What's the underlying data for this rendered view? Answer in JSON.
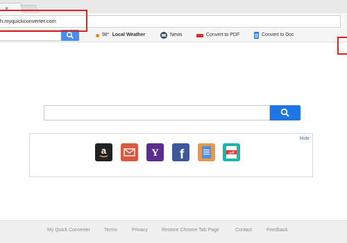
{
  "browser": {
    "tab_close_glyph": "×",
    "url": "h.myquickconverter.com"
  },
  "toolbar": {
    "weather_temp": "98°",
    "weather_label": "Local Weather",
    "news_label": "News",
    "pdf_label": "Convert to PDF",
    "doc_label": "Convert to Doc"
  },
  "search": {
    "placeholder": ""
  },
  "apps_panel": {
    "hide_label": "Hide",
    "apps": [
      {
        "name": "Amazon",
        "glyph": "a",
        "color": "#222222"
      },
      {
        "name": "Mail",
        "glyph": "✉",
        "color": "#d8593f"
      },
      {
        "name": "Yahoo",
        "glyph": "Y",
        "color": "#5c2d91"
      },
      {
        "name": "Facebook",
        "glyph": "f",
        "color": "#3b5998"
      },
      {
        "name": "Docs",
        "glyph": "▤",
        "color": "#e59a4b"
      },
      {
        "name": "PDF",
        "glyph": ".pdf",
        "color": "#1cb5a8"
      }
    ]
  },
  "footer": {
    "links": [
      "My Quick Converter",
      "Terms",
      "Privacy",
      "Restore Chrome Tab Page",
      "Contact",
      "Feedback"
    ]
  },
  "colors": {
    "accent": "#1f75e3",
    "highlight": "#e02020"
  }
}
